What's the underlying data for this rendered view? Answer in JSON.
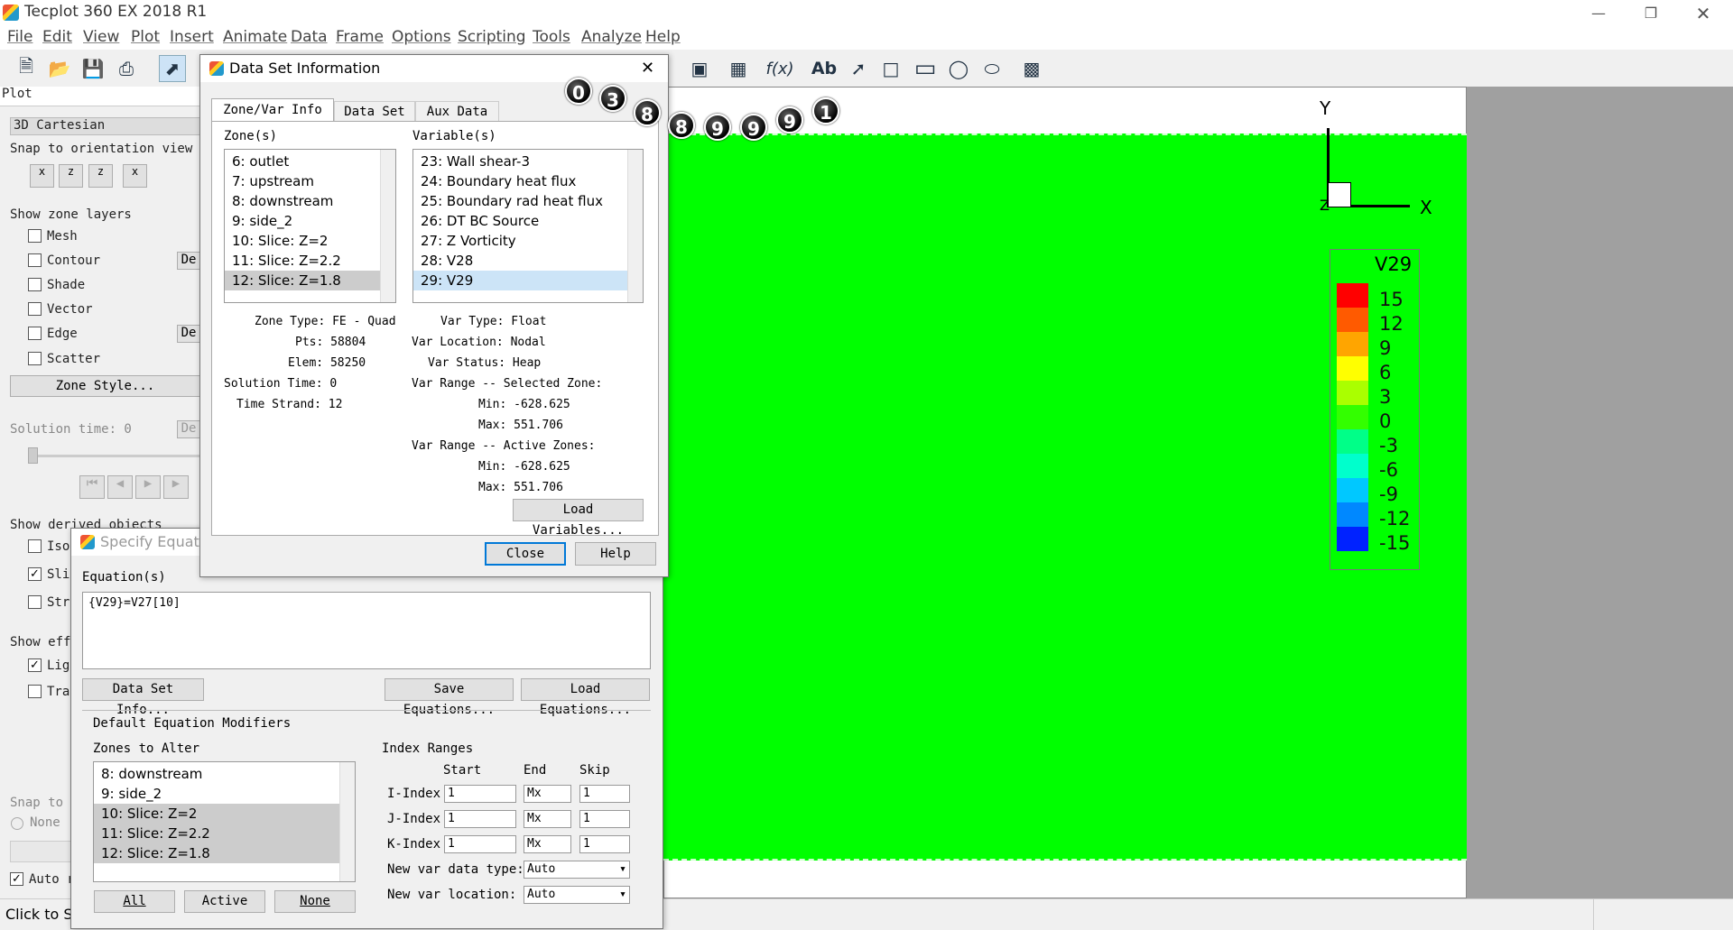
{
  "app": {
    "title": "Tecplot 360 EX 2018 R1",
    "status": "Click to Se"
  },
  "menu": [
    "File",
    "Edit",
    "View",
    "Plot",
    "Insert",
    "Animate",
    "Data",
    "Frame",
    "Options",
    "Scripting",
    "Tools",
    "Analyze",
    "Help"
  ],
  "sidebar": {
    "plot_header": "Plot",
    "plot_type": "3D Cartesian",
    "snap_label": "Snap to orientation view",
    "zone_layers_label": "Show zone layers",
    "layers": [
      "Mesh",
      "Contour",
      "Shade",
      "Vector",
      "Edge",
      "Scatter"
    ],
    "layer_btn": "De",
    "zone_style": "Zone Style...",
    "solution_time": "Solution time: 0",
    "derived_label": "Show derived objects",
    "derived": [
      "Iso",
      "Sli",
      "Str"
    ],
    "effects_label": "Show effe",
    "effects": [
      "Lig",
      "Tra"
    ],
    "snap_to": "Snap to",
    "none": "None",
    "auto": "Auto r"
  },
  "legend": {
    "title": "V29",
    "labels": [
      "15",
      "12",
      "9",
      "6",
      "3",
      "0",
      "-3",
      "-6",
      "-9",
      "-12",
      "-15"
    ],
    "colors": [
      "#ff0000",
      "#ff5a00",
      "#ffa500",
      "#ffff00",
      "#aaff00",
      "#33ff00",
      "#00ff88",
      "#00ffcc",
      "#00c8ff",
      "#0088ff",
      "#0022ff"
    ]
  },
  "axes": {
    "x": "X",
    "y": "Y",
    "z": "Z"
  },
  "balls": [
    "0",
    "3",
    "8",
    "8",
    "9",
    "9",
    "9",
    "1"
  ],
  "dsi": {
    "title": "Data Set Information",
    "tabs": [
      "Zone/Var Info",
      "Data Set",
      "Aux Data"
    ],
    "zones_label": "Zone(s)",
    "vars_label": "Variable(s)",
    "zones": [
      "6: outlet",
      "7: upstream",
      "8: downstream",
      "9: side_2",
      "10: Slice: Z=2",
      "11: Slice: Z=2.2",
      "12: Slice: Z=1.8"
    ],
    "vars": [
      "23: Wall shear-3",
      "24: Boundary heat flux",
      "25: Boundary rad heat flux",
      "26: DT BC Source",
      "27: Z Vorticity",
      "28: V28",
      "29: V29"
    ],
    "zone_info": [
      "Zone Type: FE - Quad",
      "Pts: 58804",
      "Elem: 58250",
      "Solution Time: 0",
      "Time Strand: 12"
    ],
    "var_info": [
      "Var Type: Float",
      "Var Location: Nodal",
      "Var Status: Heap",
      "Var Range -- Selected Zone:",
      "Min: -628.625",
      "Max: 551.706",
      "Var Range -- Active Zones:",
      "Min: -628.625",
      "Max: 551.706"
    ],
    "load_vars": "Load Variables...",
    "close": "Close",
    "help": "Help"
  },
  "eq": {
    "title": "Specify Equatio",
    "eq_label": "Equation(s)",
    "equation": "{V29}=V27[10]",
    "data_set_info": "Data Set Info...",
    "save": "Save Equations...",
    "load": "Load Equations...",
    "modifiers": "Default Equation Modifiers",
    "zones_alter": "Zones to Alter",
    "zones": [
      "8: downstream",
      "9: side_2",
      "10: Slice: Z=2",
      "11: Slice: Z=2.2",
      "12: Slice: Z=1.8"
    ],
    "all": "All",
    "active": "Active",
    "none": "None",
    "index_ranges": "Index Ranges",
    "cols": [
      "Start",
      "End",
      "Skip"
    ],
    "rows": [
      {
        "label": "I-Index",
        "start": "1",
        "end": "Mx",
        "skip": "1"
      },
      {
        "label": "J-Index",
        "start": "1",
        "end": "Mx",
        "skip": "1"
      },
      {
        "label": "K-Index",
        "start": "1",
        "end": "Mx",
        "skip": "1"
      }
    ],
    "new_type_label": "New var data type:",
    "new_type": "Auto",
    "new_loc_label": "New var location:",
    "new_loc": "Auto"
  }
}
